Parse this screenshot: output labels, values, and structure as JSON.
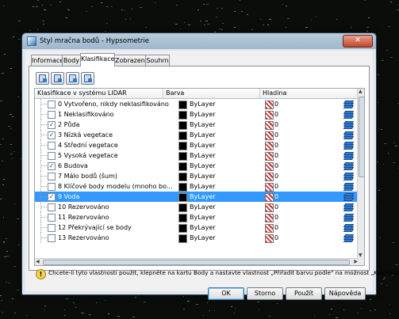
{
  "window": {
    "title": "Styl mračna bodů - Hypsometrie",
    "close_label": "✕"
  },
  "tabs": [
    {
      "label": "Informace",
      "active": false
    },
    {
      "label": "Body",
      "active": false
    },
    {
      "label": "Klasifikace",
      "active": true
    },
    {
      "label": "Zobrazení",
      "active": false
    },
    {
      "label": "Souhrn",
      "active": false
    }
  ],
  "toolbar": {
    "icons": [
      "new-classification-icon",
      "import-classification-icon",
      "export-classification-icon",
      "edit-classification-icon"
    ]
  },
  "table": {
    "headers": {
      "classification": "Klasifikace v systému LIDAR",
      "color": "Barva",
      "layer": "Hladina"
    },
    "rows": [
      {
        "label": "0 Vytvořeno, nikdy neklasifikováno",
        "checked": false,
        "color": "ByLayer",
        "layer": "0",
        "selected": false
      },
      {
        "label": "1 Neklasifikováno",
        "checked": false,
        "color": "ByLayer",
        "layer": "0",
        "selected": false
      },
      {
        "label": "2 Půda",
        "checked": true,
        "color": "ByLayer",
        "layer": "0",
        "selected": false
      },
      {
        "label": "3 Nízká vegetace",
        "checked": true,
        "color": "ByLayer",
        "layer": "0",
        "selected": false
      },
      {
        "label": "4 Střední vegetace",
        "checked": false,
        "color": "ByLayer",
        "layer": "0",
        "selected": false
      },
      {
        "label": "5 Vysoká vegetace",
        "checked": false,
        "color": "ByLayer",
        "layer": "0",
        "selected": false
      },
      {
        "label": "6 Budova",
        "checked": true,
        "color": "ByLayer",
        "layer": "0",
        "selected": false
      },
      {
        "label": "7 Málo bodů (šum)",
        "checked": false,
        "color": "ByLayer",
        "layer": "0",
        "selected": false
      },
      {
        "label": "8 Klíčové body modelu (mnoho bo...",
        "checked": false,
        "color": "ByLayer",
        "layer": "0",
        "selected": false
      },
      {
        "label": "9 Voda",
        "checked": true,
        "color": "ByLayer",
        "layer": "0",
        "selected": true
      },
      {
        "label": "10 Rezervováno",
        "checked": false,
        "color": "ByLayer",
        "layer": "0",
        "selected": false
      },
      {
        "label": "11 Rezervováno",
        "checked": false,
        "color": "ByLayer",
        "layer": "0",
        "selected": false
      },
      {
        "label": "12 Překrývající se body",
        "checked": false,
        "color": "ByLayer",
        "layer": "0",
        "selected": false
      },
      {
        "label": "13 Rezervováno",
        "checked": false,
        "color": "ByLayer",
        "layer": "0",
        "selected": false
      }
    ]
  },
  "info": {
    "text": "Chcete-li tyto vlastnosti použít, klepněte na kartu Body a nastavte vlastnost „Přiřadit barvu podle\" na možnost „Klasifikace\"."
  },
  "buttons": {
    "ok": "OK",
    "cancel": "Storno",
    "apply": "Použít",
    "help": "Nápověda"
  },
  "colors": {
    "selection": "#3399ff",
    "point_cloud": "#4fa83a",
    "titlebar": "#a9bfd4"
  }
}
